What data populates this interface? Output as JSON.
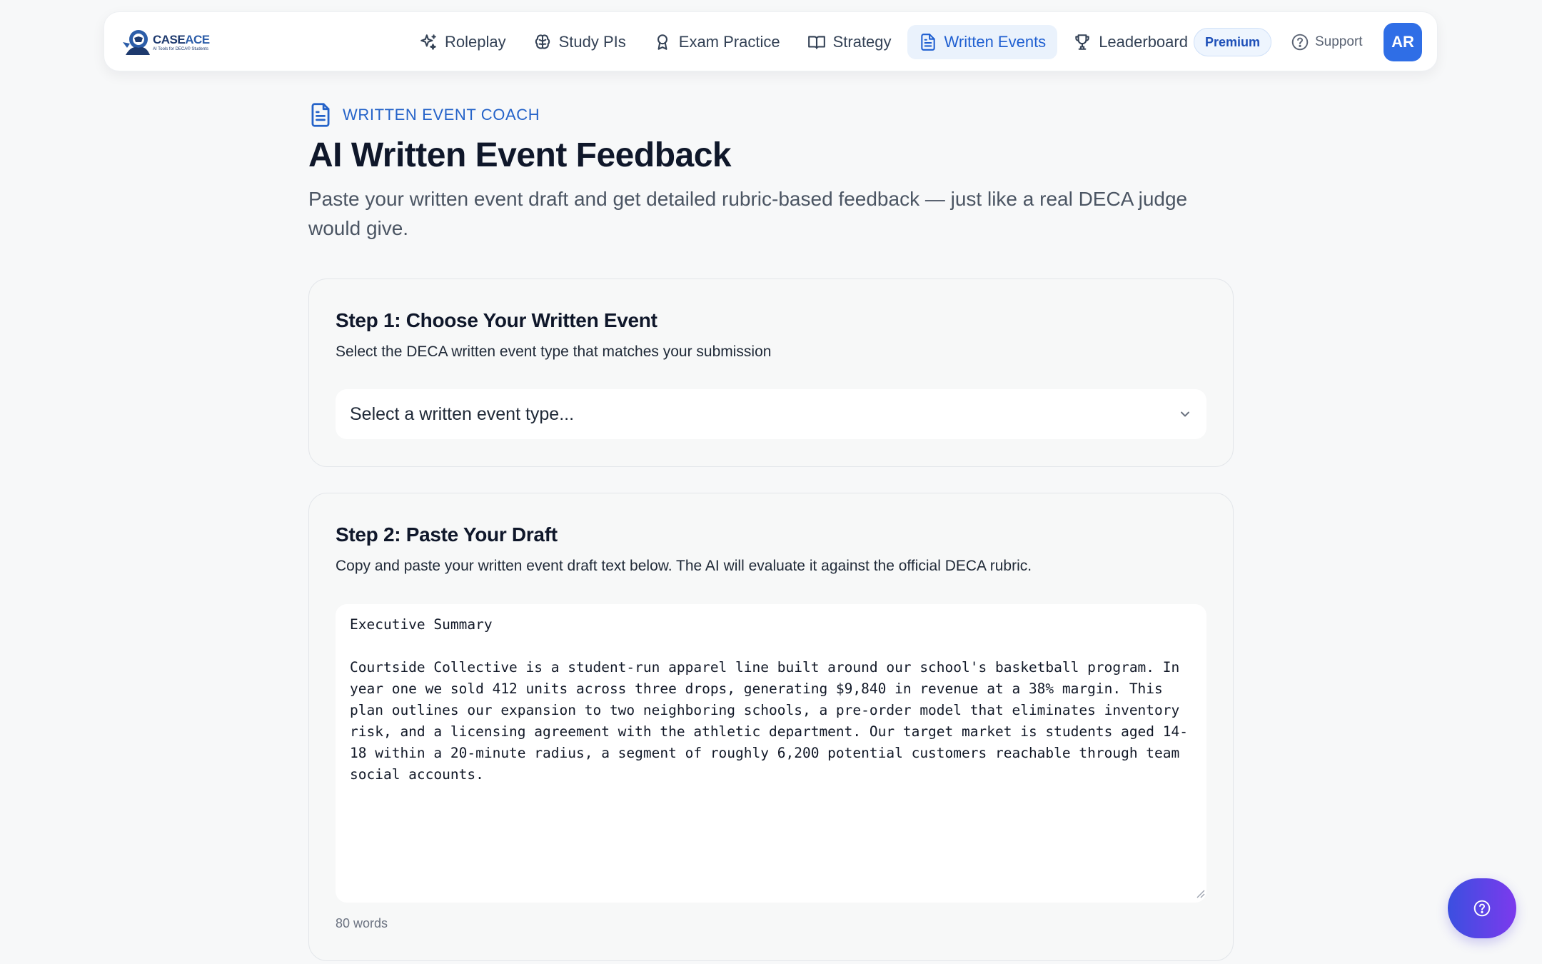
{
  "nav": {
    "logo": {
      "name_part1": "CASE",
      "name_part2": "ACE",
      "tagline": "AI Tools for DECA® Students"
    },
    "links": [
      {
        "label": "Roleplay",
        "icon": "sparkle-icon",
        "active": false
      },
      {
        "label": "Study PIs",
        "icon": "brain-icon",
        "active": false
      },
      {
        "label": "Exam Practice",
        "icon": "award-icon",
        "active": false
      },
      {
        "label": "Strategy",
        "icon": "book-open-icon",
        "active": false
      },
      {
        "label": "Written Events",
        "icon": "document-icon",
        "active": true
      },
      {
        "label": "Leaderboard",
        "icon": "trophy-icon",
        "active": false
      }
    ],
    "premium_label": "Premium",
    "support_label": "Support",
    "avatar_initials": "AR"
  },
  "header": {
    "eyebrow": "WRITTEN EVENT COACH",
    "title": "AI Written Event Feedback",
    "subtitle": "Paste your written event draft and get detailed rubric-based feedback — just like a real DECA judge would give."
  },
  "step1": {
    "title": "Step 1: Choose Your Written Event",
    "description": "Select the DECA written event type that matches your submission",
    "select_value": "Select a written event type..."
  },
  "step2": {
    "title": "Step 2: Paste Your Draft",
    "description": "Copy and paste your written event draft text below. The AI will evaluate it against the official DECA rubric.",
    "draft_text": "Executive Summary\n\nCourtside Collective is a student-run apparel line built around our school's basketball program. In year one we sold 412 units across three drops, generating $9,840 in revenue at a 38% margin. This plan outlines our expansion to two neighboring schools, a pre-order model that eliminates inventory risk, and a licensing agreement with the athletic department. Our target market is students aged 14-18 within a 20-minute radius, a segment of roughly 6,200 potential customers reachable through team social accounts.",
    "word_count": "80 words"
  },
  "colors": {
    "accent": "#2563c9",
    "active_nav_bg": "#eaf2fc",
    "avatar_bg": "#2f6ee6",
    "fab_gradient_start": "#3b4fe0",
    "fab_gradient_end": "#7c3aed"
  }
}
